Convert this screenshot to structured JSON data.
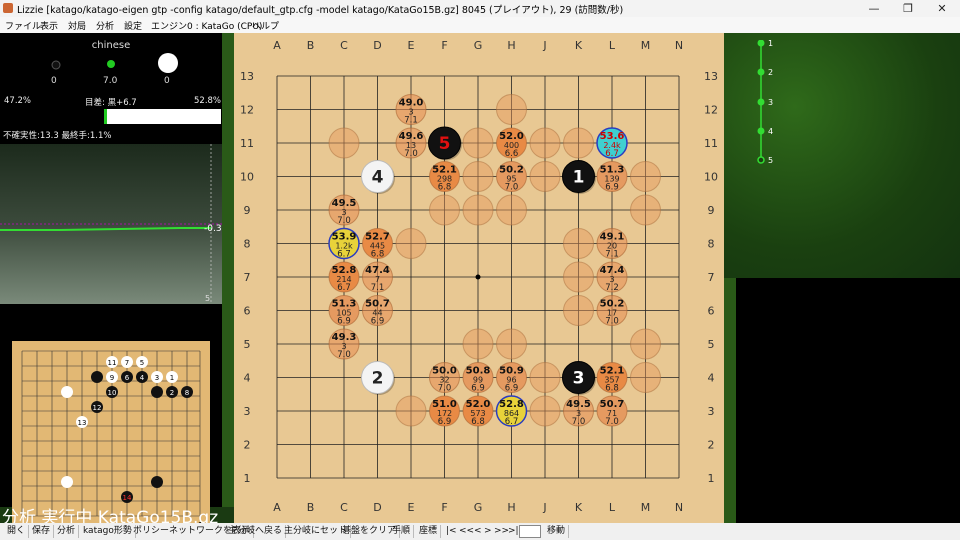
{
  "window": {
    "title": "Lizzie [katago/katago-eigen gtp -config katago/default_gtp.cfg -model katago/KataGo15B.gz] 8045 (プレイアウト), 29 (訪問数/秒)",
    "minimize": "—",
    "maximize": "❐",
    "close": "✕"
  },
  "menu": [
    "ファイル",
    "表示",
    "対局",
    "分析",
    "設定",
    "エンジン0 : KataGo (CPU)",
    "ヘルプ"
  ],
  "capture": {
    "rule": "chinese",
    "black": "0",
    "komi": "7.0",
    "white": "0"
  },
  "winrate": {
    "black": "47.2%",
    "diff": "目差: 黒+6.7",
    "white": "52.8%",
    "black_fraction": 0.472,
    "uncertainty": "不確実性:13.3 最終手:1.1%"
  },
  "graph": {
    "value": "-0.3",
    "move": "5"
  },
  "mini_board": {
    "move_label": "1"
  },
  "status": "分析 実行中 KataGo15B.gz",
  "board": {
    "cols": [
      "A",
      "B",
      "C",
      "D",
      "E",
      "F",
      "G",
      "H",
      "J",
      "K",
      "L",
      "M",
      "N"
    ],
    "rows": [
      "13",
      "12",
      "11",
      "10",
      "9",
      "8",
      "7",
      "6",
      "5",
      "4",
      "3",
      "2",
      "1"
    ],
    "stones": [
      {
        "col": "K",
        "row": "10",
        "color": "black",
        "label": "1"
      },
      {
        "col": "D",
        "row": "4",
        "color": "white",
        "label": "2"
      },
      {
        "col": "K",
        "row": "4",
        "color": "black",
        "label": "3"
      },
      {
        "col": "D",
        "row": "10",
        "color": "white",
        "label": "4"
      },
      {
        "col": "F",
        "row": "11",
        "color": "black",
        "label": "5"
      }
    ],
    "suggestions": [
      {
        "col": "L",
        "row": "11",
        "w": "53.6",
        "v": "2.4k",
        "s": "6.7",
        "best": true
      },
      {
        "col": "C",
        "row": "8",
        "w": "53.9",
        "v": "1.2k",
        "s": "6.7",
        "yellow": true
      },
      {
        "col": "H",
        "row": "3",
        "w": "52.8",
        "v": "864",
        "s": "6.7",
        "yellow": true
      },
      {
        "col": "G",
        "row": "3",
        "w": "52.0",
        "v": "573",
        "s": "6.8"
      },
      {
        "col": "D",
        "row": "8",
        "w": "52.7",
        "v": "445",
        "s": "6.8"
      },
      {
        "col": "H",
        "row": "11",
        "w": "52.0",
        "v": "400",
        "s": "6.6"
      },
      {
        "col": "L",
        "row": "4",
        "w": "52.1",
        "v": "357",
        "s": "6.8"
      },
      {
        "col": "F",
        "row": "10",
        "w": "52.1",
        "v": "298",
        "s": "6.8"
      },
      {
        "col": "C",
        "row": "7",
        "w": "52.8",
        "v": "214",
        "s": "6.7"
      },
      {
        "col": "F",
        "row": "3",
        "w": "51.0",
        "v": "172",
        "s": "6.9"
      },
      {
        "col": "L",
        "row": "10",
        "w": "51.3",
        "v": "139",
        "s": "6.9"
      },
      {
        "col": "C",
        "row": "6",
        "w": "51.3",
        "v": "105",
        "s": "6.9"
      },
      {
        "col": "G",
        "row": "4",
        "w": "50.8",
        "v": "99",
        "s": "6.9"
      },
      {
        "col": "H",
        "row": "4",
        "w": "50.9",
        "v": "96",
        "s": "6.9"
      },
      {
        "col": "H",
        "row": "10",
        "w": "50.2",
        "v": "95",
        "s": "7.0"
      },
      {
        "col": "L",
        "row": "3",
        "w": "50.7",
        "v": "71",
        "s": "7.0"
      },
      {
        "col": "D",
        "row": "6",
        "w": "50.7",
        "v": "44",
        "s": "6.9"
      },
      {
        "col": "F",
        "row": "4",
        "w": "50.0",
        "v": "32",
        "s": "7.0"
      },
      {
        "col": "L",
        "row": "8",
        "w": "49.1",
        "v": "20",
        "s": "7.1"
      },
      {
        "col": "L",
        "row": "6",
        "w": "50.2",
        "v": "17",
        "s": "7.0"
      },
      {
        "col": "E",
        "row": "11",
        "w": "49.6",
        "v": "13",
        "s": "7.0"
      },
      {
        "col": "D",
        "row": "7",
        "w": "47.4",
        "v": "7",
        "s": "7.1"
      },
      {
        "col": "E",
        "row": "12",
        "w": "49.0",
        "v": "3",
        "s": "7.1"
      },
      {
        "col": "C",
        "row": "9",
        "w": "49.5",
        "v": "3",
        "s": "7.0"
      },
      {
        "col": "L",
        "row": "7",
        "w": "47.4",
        "v": "3",
        "s": "7.2"
      },
      {
        "col": "C",
        "row": "5",
        "w": "49.3",
        "v": "3",
        "s": "7.0"
      },
      {
        "col": "K",
        "row": "3",
        "w": "49.5",
        "v": "3",
        "s": "7.0"
      }
    ],
    "empty_candidates": [
      {
        "col": "C",
        "row": "11"
      },
      {
        "col": "G",
        "row": "11"
      },
      {
        "col": "J",
        "row": "11"
      },
      {
        "col": "K",
        "row": "11"
      },
      {
        "col": "H",
        "row": "12"
      },
      {
        "col": "G",
        "row": "10"
      },
      {
        "col": "J",
        "row": "10"
      },
      {
        "col": "M",
        "row": "10"
      },
      {
        "col": "F",
        "row": "9"
      },
      {
        "col": "G",
        "row": "9"
      },
      {
        "col": "H",
        "row": "9"
      },
      {
        "col": "M",
        "row": "9"
      },
      {
        "col": "E",
        "row": "8"
      },
      {
        "col": "K",
        "row": "8"
      },
      {
        "col": "K",
        "row": "7"
      },
      {
        "col": "K",
        "row": "6"
      },
      {
        "col": "G",
        "row": "5"
      },
      {
        "col": "H",
        "row": "5"
      },
      {
        "col": "M",
        "row": "5"
      },
      {
        "col": "J",
        "row": "4"
      },
      {
        "col": "M",
        "row": "4"
      },
      {
        "col": "E",
        "row": "3"
      },
      {
        "col": "J",
        "row": "3"
      }
    ]
  },
  "tree_nodes": [
    "1",
    "2",
    "3",
    "4",
    "5"
  ],
  "toolbar": [
    "開く",
    "保存",
    "分析",
    "katago形勢",
    "ポリシーネットワークを表示",
    "主分岐へ戻る",
    "主分岐にセット",
    "碁盤をクリア",
    "手順",
    "座標",
    "|<",
    "<<",
    "<",
    ">",
    ">>",
    ">|",
    "",
    "移動"
  ]
}
